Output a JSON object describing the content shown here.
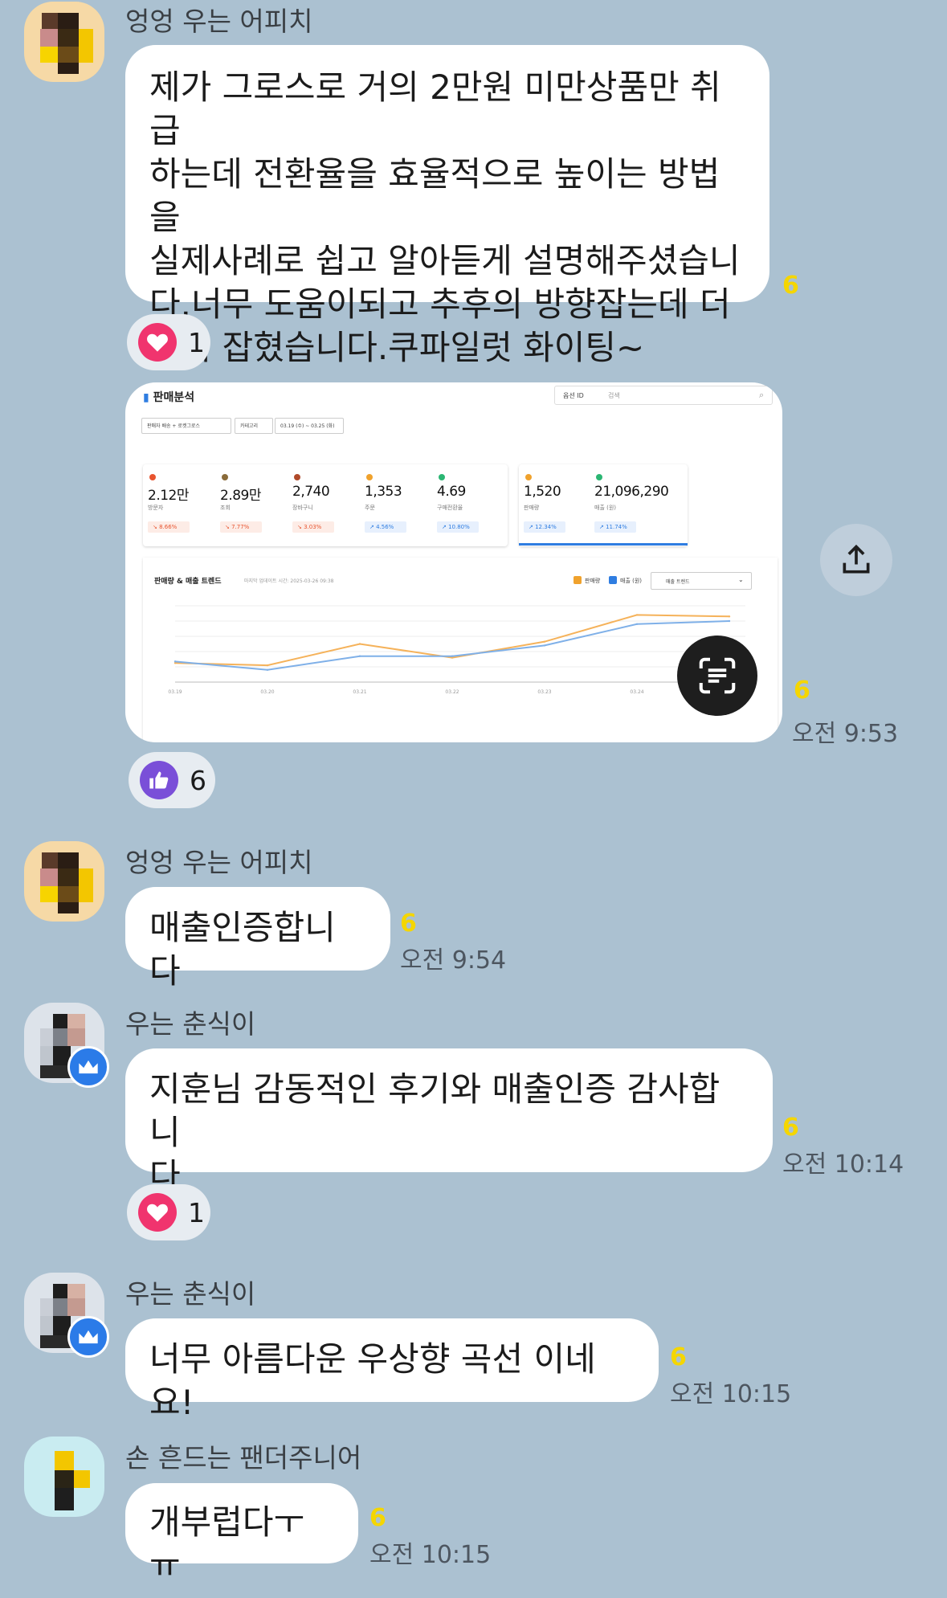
{
  "chat": {
    "messages": [
      {
        "sender": "엉엉 우는 어피치",
        "text": "제가 그로스로 거의 2만원 미만상품만 취급\n하는데 전환율을 효율적으로 높이는 방법을\n실제사례로 쉽고 알아듣게 설명해주셨습니\n다.너무 도움이되고 추후의 방향잡는데 더\n감이 잡혔습니다.쿠파일럿 화이팅~",
        "unread": "6",
        "reaction": {
          "icon": "heart-icon",
          "count": "1"
        }
      },
      {
        "image": "sales-analysis-screenshot",
        "unread": "6",
        "time": "오전 9:53",
        "reaction": {
          "icon": "thumbs-up-icon",
          "count": "6"
        }
      },
      {
        "sender": "엉엉 우는 어피치",
        "text": "매출인증합니다",
        "unread": "6",
        "time": "오전 9:54"
      },
      {
        "sender": "우는 춘식이",
        "text": "지훈님 감동적인 후기와 매출인증 감사합니\n다",
        "unread": "6",
        "time": "오전 10:14",
        "reaction": {
          "icon": "heart-icon",
          "count": "1"
        }
      },
      {
        "sender": "우는 춘식이",
        "text": "너무 아름다운 우상향 곡선 이네요!",
        "unread": "6",
        "time": "오전 10:15"
      },
      {
        "sender": "손 흔드는 팬더주니어",
        "text": "개부럽다ㅜㅠ",
        "unread": "6",
        "time": "오전 10:15"
      }
    ]
  },
  "screenshot": {
    "title": "판매분석",
    "search_select": "옵션 ID",
    "search_placeholder": "검색",
    "filter_seller": "판매자 배송 + 로켓그로스",
    "filter_category": "카테고리",
    "filter_date": "03.19 (수) ~ 03.25 (화)",
    "kpis": [
      {
        "value": "2.12만",
        "label": "방문자",
        "change": "8.66%",
        "dir": "down",
        "color": "#e8542f"
      },
      {
        "value": "2.89만",
        "label": "조회",
        "change": "7.77%",
        "dir": "down",
        "color": "#8a6b3a"
      },
      {
        "value": "2,740",
        "label": "장바구니",
        "change": "3.03%",
        "dir": "down",
        "color": "#b04a2a"
      },
      {
        "value": "1,353",
        "label": "주문",
        "change": "4.56%",
        "dir": "up",
        "color": "#f0a22d"
      },
      {
        "value": "4.69",
        "label": "구매전환율",
        "change": "10.80%",
        "dir": "up",
        "color": "#2bb673"
      },
      {
        "value": "1,520",
        "label": "판매량",
        "change": "12.34%",
        "dir": "up",
        "color": "#f0a22d"
      },
      {
        "value": "21,096,290",
        "label": "매출 (원)",
        "change": "11.74%",
        "dir": "up",
        "color": "#2bb673"
      }
    ],
    "trend_title": "판매량 & 매출 트렌드",
    "trend_update": "마지막 업데이트 시간: 2025-03-26 09:38",
    "legend_qty": "판매량",
    "legend_rev": "매출 (원)",
    "trend_select": "매출 트렌드"
  },
  "chart_data": {
    "type": "line",
    "categories": [
      "03.19",
      "03.20",
      "03.21",
      "03.22",
      "03.23",
      "03.24",
      "03.25"
    ],
    "series": [
      {
        "name": "판매량",
        "color": "#f5b25a",
        "values": [
          185,
          182,
          210,
          192,
          213,
          248,
          246
        ]
      },
      {
        "name": "매출 (원)",
        "color": "#7fb0e8",
        "values": [
          187,
          176,
          194,
          194,
          208,
          236,
          240
        ]
      }
    ],
    "ylim": [
      160,
      260
    ]
  },
  "colors": {
    "background": "#abc1d1",
    "unread": "#f5d600",
    "heart": "#f0346e",
    "thumbs": "#7a4fd8",
    "crown_badge": "#2b7be8"
  }
}
